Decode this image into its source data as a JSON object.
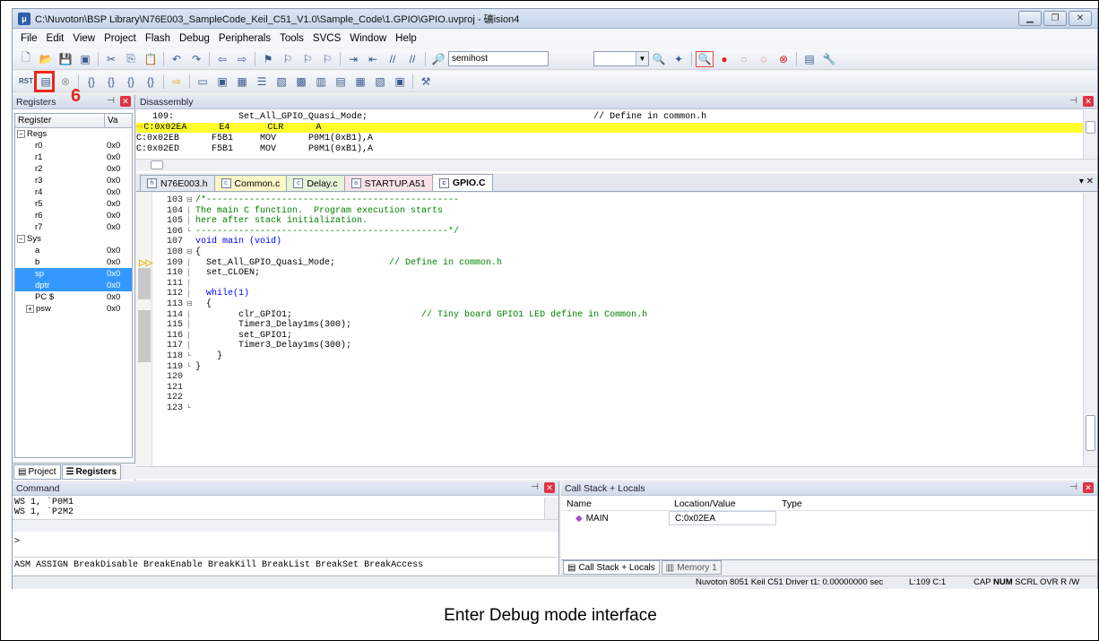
{
  "window": {
    "title": "C:\\Nuvoton\\BSP Library\\N76E003_SampleCode_Keil_C51_V1.0\\Sample_Code\\1.GPIO\\GPIO.uvproj - 礦ision4",
    "app_icon": "uv-icon"
  },
  "menu": [
    "File",
    "Edit",
    "View",
    "Project",
    "Flash",
    "Debug",
    "Peripherals",
    "Tools",
    "SVCS",
    "Window",
    "Help"
  ],
  "toolbar": {
    "combo_value": "semihost",
    "highlight_color": "#e8281c"
  },
  "annotation": {
    "step_number": "6"
  },
  "registers_panel": {
    "title": "Registers",
    "columns": [
      "Register",
      "Va"
    ],
    "rows": [
      {
        "name": "Regs",
        "value": "",
        "level": 0,
        "tree": "−"
      },
      {
        "name": "r0",
        "value": "0x0",
        "level": 2
      },
      {
        "name": "r1",
        "value": "0x0",
        "level": 2
      },
      {
        "name": "r2",
        "value": "0x0",
        "level": 2
      },
      {
        "name": "r3",
        "value": "0x0",
        "level": 2
      },
      {
        "name": "r4",
        "value": "0x0",
        "level": 2
      },
      {
        "name": "r5",
        "value": "0x0",
        "level": 2
      },
      {
        "name": "r6",
        "value": "0x0",
        "level": 2
      },
      {
        "name": "r7",
        "value": "0x0",
        "level": 2
      },
      {
        "name": "Sys",
        "value": "",
        "level": 0,
        "tree": "−"
      },
      {
        "name": "a",
        "value": "0x0",
        "level": 2
      },
      {
        "name": "b",
        "value": "0x0",
        "level": 2
      },
      {
        "name": "sp",
        "value": "0x0",
        "level": 2,
        "selected": true
      },
      {
        "name": "dptr",
        "value": "0x0",
        "level": 2,
        "selected": true
      },
      {
        "name": "PC $",
        "value": "0x0",
        "level": 2
      },
      {
        "name": "psw",
        "value": "0x0",
        "level": 1,
        "tree": "+"
      }
    ],
    "tabs": [
      "Project",
      "Registers"
    ]
  },
  "disassembly": {
    "title": "Disassembly",
    "lines": [
      {
        "text": "   109:            Set_All_GPIO_Quasi_Mode;                                          // Define in common.h",
        "current": false
      },
      {
        "text": "C:0x02EA      E4       CLR      A",
        "current": true
      },
      {
        "text": "C:0x02EB      F5B1     MOV      P0M1(0xB1),A",
        "current": false
      },
      {
        "text": "C:0x02ED      F5B1     MOV      P0M1(0xB1),A",
        "current": false
      }
    ]
  },
  "editor_tabs": [
    {
      "label": "N76E003.h",
      "active": false,
      "color": "#e3e8f0"
    },
    {
      "label": "Common.c",
      "active": false,
      "color": "#fdf6c8"
    },
    {
      "label": "Delay.c",
      "active": false,
      "color": "#e6f4d8"
    },
    {
      "label": "STARTUP.A51",
      "active": false,
      "color": "#f9e3e8"
    },
    {
      "label": "GPIO.C",
      "active": true,
      "color": "#ffffff"
    }
  ],
  "editor": {
    "lines": [
      {
        "n": "103",
        "fold": "⊟",
        "code": "/*-----------------------------------------------",
        "cls": "cm"
      },
      {
        "n": "104",
        "fold": "│",
        "code": "The main C function.  Program execution starts",
        "cls": "cm"
      },
      {
        "n": "105",
        "fold": "│",
        "code": "here after stack initialization.",
        "cls": "cm"
      },
      {
        "n": "106",
        "fold": "└",
        "code": "-----------------------------------------------*/",
        "cls": "cm"
      },
      {
        "n": "107",
        "fold": "",
        "code": "void main (void)",
        "cls": "kw"
      },
      {
        "n": "108",
        "fold": "⊟",
        "code": "{",
        "cls": ""
      },
      {
        "n": "109",
        "fold": "│",
        "code": "  Set_All_GPIO_Quasi_Mode;",
        "cls": "",
        "comment": "          // Define in common.h"
      },
      {
        "n": "110",
        "fold": "│",
        "code": "  set_CLOEN;",
        "cls": ""
      },
      {
        "n": "111",
        "fold": "│",
        "code": "",
        "cls": ""
      },
      {
        "n": "112",
        "fold": "│",
        "code": "  while(1)",
        "cls": "kw"
      },
      {
        "n": "113",
        "fold": "⊟",
        "code": "  {",
        "cls": ""
      },
      {
        "n": "114",
        "fold": "│",
        "code": "        clr_GPIO1;",
        "cls": "",
        "comment": "                        // Tiny board GPIO1 LED define in Common.h"
      },
      {
        "n": "115",
        "fold": "│",
        "code": "        Timer3_Delay1ms(300);",
        "cls": ""
      },
      {
        "n": "116",
        "fold": "│",
        "code": "        set_GPIO1;",
        "cls": ""
      },
      {
        "n": "117",
        "fold": "│",
        "code": "        Timer3_Delay1ms(300);",
        "cls": ""
      },
      {
        "n": "118",
        "fold": "└",
        "code": "    }",
        "cls": ""
      },
      {
        "n": "119",
        "fold": "└",
        "code": "}",
        "cls": ""
      },
      {
        "n": "120",
        "fold": "",
        "code": "",
        "cls": ""
      },
      {
        "n": "121",
        "fold": "",
        "code": "",
        "cls": ""
      },
      {
        "n": "122",
        "fold": "",
        "code": "",
        "cls": ""
      },
      {
        "n": "123",
        "fold": "└",
        "code": "",
        "cls": ""
      }
    ]
  },
  "command_panel": {
    "title": "Command",
    "lines": [
      "WS 1, `P0M1",
      "WS 1, `P2M2"
    ],
    "prompt": ">",
    "hint": "ASM ASSIGN BreakDisable BreakEnable BreakKill BreakList BreakSet BreakAccess"
  },
  "call_stack": {
    "title": "Call Stack + Locals",
    "columns": [
      "Name",
      "Location/Value",
      "Type"
    ],
    "rows": [
      {
        "name": "MAIN",
        "location": "C:0x02EA",
        "type": ""
      }
    ],
    "tabs": [
      "Call Stack + Locals",
      "Memory 1"
    ]
  },
  "status": {
    "driver": "Nuvoton 8051 Keil C51 Driver  t1: 0.00000000 sec",
    "position": "L:109 C:1",
    "flags": [
      "CAP",
      "NUM",
      "SCRL",
      "OVR",
      "R /W"
    ]
  },
  "caption": "Enter Debug mode interface"
}
